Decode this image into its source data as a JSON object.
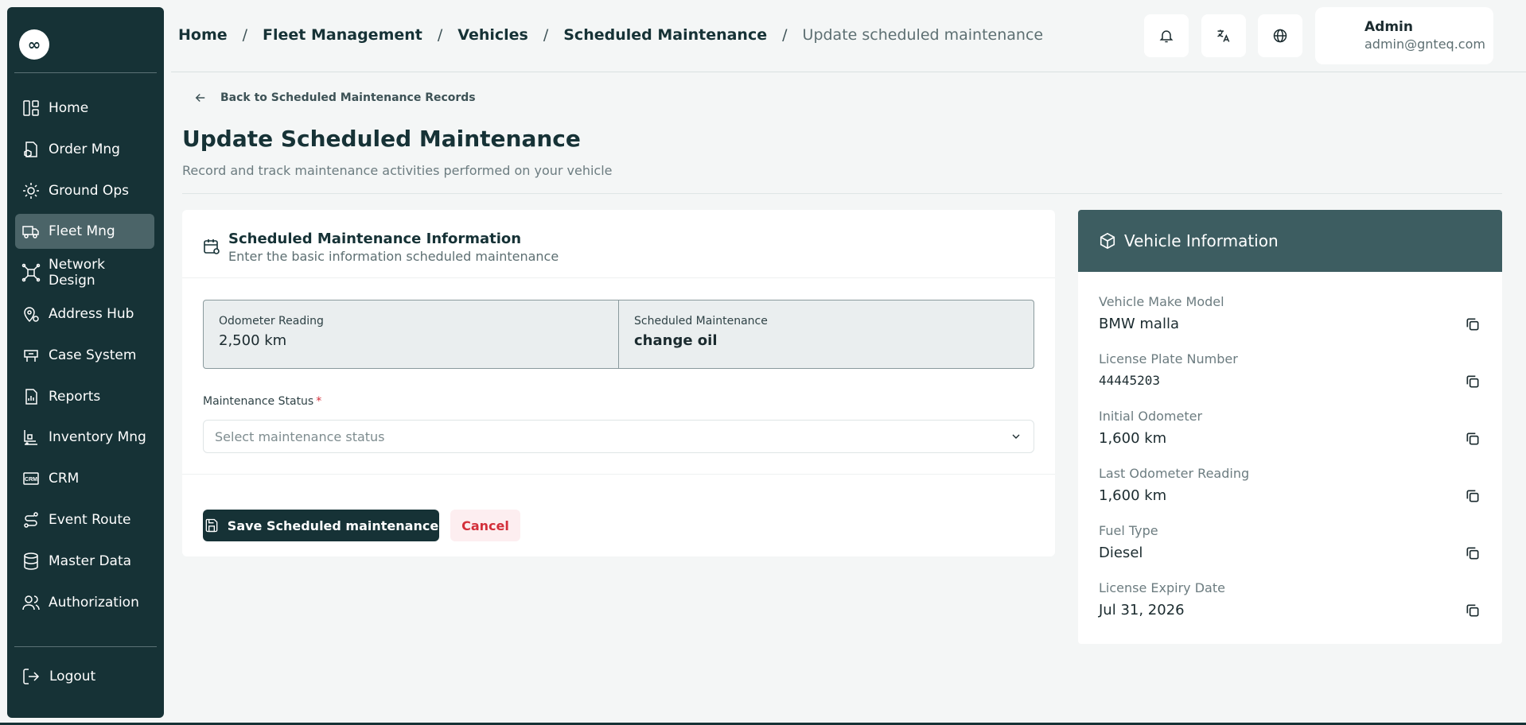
{
  "sidebar": {
    "logo": "∞",
    "items": [
      {
        "label": "Home",
        "icon": "home-icon"
      },
      {
        "label": "Order Mng",
        "icon": "order-icon"
      },
      {
        "label": "Ground Ops",
        "icon": "ground-ops-icon"
      },
      {
        "label": "Fleet Mng",
        "icon": "truck-icon",
        "active": true
      },
      {
        "label": "Network Design",
        "icon": "network-icon"
      },
      {
        "label": "Address Hub",
        "icon": "map-pin-icon"
      },
      {
        "label": "Case System",
        "icon": "case-icon"
      },
      {
        "label": "Reports",
        "icon": "reports-icon"
      },
      {
        "label": "Inventory Mng",
        "icon": "inventory-icon"
      },
      {
        "label": "CRM",
        "icon": "crm-icon"
      },
      {
        "label": "Event Route",
        "icon": "route-icon"
      },
      {
        "label": "Master Data",
        "icon": "database-icon"
      },
      {
        "label": "Authorization",
        "icon": "users-icon"
      }
    ],
    "logout_label": "Logout"
  },
  "header": {
    "breadcrumbs": [
      "Home",
      "Fleet Management",
      "Vehicles",
      "Scheduled Maintenance",
      "Update scheduled maintenance"
    ],
    "separator": "/",
    "user": {
      "name": "Admin",
      "email": "admin@gnteq.com"
    }
  },
  "page": {
    "back_label": "Back to Scheduled Maintenance Records",
    "title": "Update Scheduled Maintenance",
    "subtitle": "Record and track maintenance activities performed on your vehicle"
  },
  "form": {
    "title": "Scheduled Maintenance Information",
    "subtitle": "Enter the basic information scheduled maintenance",
    "odometer_label": "Odometer Reading",
    "odometer_value": "2,500 km",
    "maintenance_label": "Scheduled Maintenance",
    "maintenance_value": "change oil",
    "status_label": "Maintenance Status",
    "required_mark": "*",
    "status_placeholder": "Select maintenance status",
    "save_label": "Save Scheduled maintenance",
    "cancel_label": "Cancel"
  },
  "vehicle": {
    "title": "Vehicle Information",
    "fields": [
      {
        "label": "Vehicle Make Model",
        "value": "BMW malla"
      },
      {
        "label": "License Plate Number",
        "value": "44445203"
      },
      {
        "label": "Initial Odometer",
        "value": "1,600 km"
      },
      {
        "label": "Last Odometer Reading",
        "value": "1,600 km"
      },
      {
        "label": "Fuel Type",
        "value": "Diesel"
      },
      {
        "label": "License Expiry Date",
        "value": "Jul 31, 2026"
      }
    ]
  },
  "colors": {
    "sidebar": "#163236",
    "active": "#4b6468",
    "accent": "#3d5d61",
    "danger": "#d32f3a"
  }
}
